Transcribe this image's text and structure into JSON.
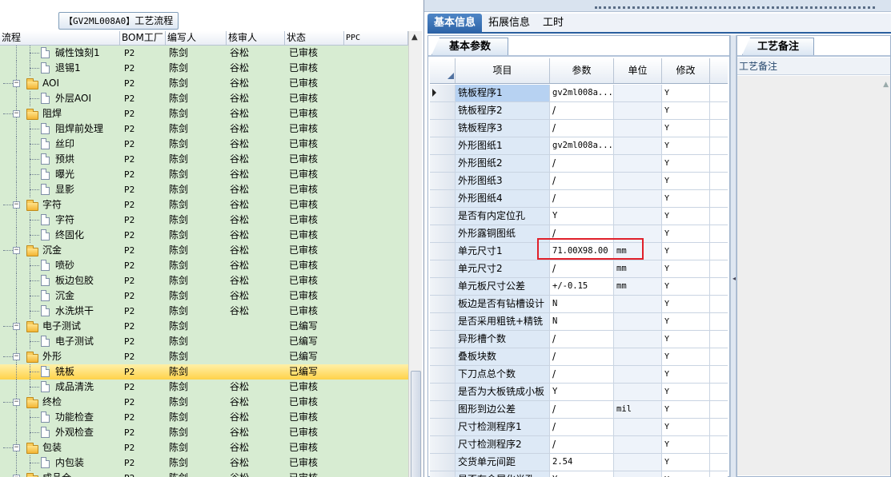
{
  "left": {
    "title_code": "【GV2ML008A0】",
    "title_suffix": "工艺流程",
    "columns": [
      "流程",
      "BOM工厂",
      "编写人",
      "核审人",
      "状态",
      "PPC"
    ],
    "rows": [
      {
        "name": "碱性蚀刻1",
        "type": "doc",
        "level": 2,
        "bom": "P2",
        "writer": "陈剑",
        "reviewer": "谷松",
        "status": "已审核"
      },
      {
        "name": "退锡1",
        "type": "doc",
        "level": 2,
        "bom": "P2",
        "writer": "陈剑",
        "reviewer": "谷松",
        "status": "已审核"
      },
      {
        "name": "AOI",
        "type": "folder",
        "level": 1,
        "bom": "P2",
        "writer": "陈剑",
        "reviewer": "谷松",
        "status": "已审核"
      },
      {
        "name": "外层AOI",
        "type": "doc",
        "level": 2,
        "bom": "P2",
        "writer": "陈剑",
        "reviewer": "谷松",
        "status": "已审核"
      },
      {
        "name": "阻焊",
        "type": "folder",
        "level": 1,
        "bom": "P2",
        "writer": "陈剑",
        "reviewer": "谷松",
        "status": "已审核"
      },
      {
        "name": "阻焊前处理",
        "type": "doc",
        "level": 2,
        "bom": "P2",
        "writer": "陈剑",
        "reviewer": "谷松",
        "status": "已审核"
      },
      {
        "name": "丝印",
        "type": "doc",
        "level": 2,
        "bom": "P2",
        "writer": "陈剑",
        "reviewer": "谷松",
        "status": "已审核"
      },
      {
        "name": "预烘",
        "type": "doc",
        "level": 2,
        "bom": "P2",
        "writer": "陈剑",
        "reviewer": "谷松",
        "status": "已审核"
      },
      {
        "name": "曝光",
        "type": "doc",
        "level": 2,
        "bom": "P2",
        "writer": "陈剑",
        "reviewer": "谷松",
        "status": "已审核"
      },
      {
        "name": "显影",
        "type": "doc",
        "level": 2,
        "bom": "P2",
        "writer": "陈剑",
        "reviewer": "谷松",
        "status": "已审核"
      },
      {
        "name": "字符",
        "type": "folder",
        "level": 1,
        "bom": "P2",
        "writer": "陈剑",
        "reviewer": "谷松",
        "status": "已审核"
      },
      {
        "name": "字符",
        "type": "doc",
        "level": 2,
        "bom": "P2",
        "writer": "陈剑",
        "reviewer": "谷松",
        "status": "已审核"
      },
      {
        "name": "终固化",
        "type": "doc",
        "level": 2,
        "bom": "P2",
        "writer": "陈剑",
        "reviewer": "谷松",
        "status": "已审核"
      },
      {
        "name": "沉金",
        "type": "folder",
        "level": 1,
        "bom": "P2",
        "writer": "陈剑",
        "reviewer": "谷松",
        "status": "已审核"
      },
      {
        "name": "喷砂",
        "type": "doc",
        "level": 2,
        "bom": "P2",
        "writer": "陈剑",
        "reviewer": "谷松",
        "status": "已审核"
      },
      {
        "name": "板边包胶",
        "type": "doc",
        "level": 2,
        "bom": "P2",
        "writer": "陈剑",
        "reviewer": "谷松",
        "status": "已审核"
      },
      {
        "name": "沉金",
        "type": "doc",
        "level": 2,
        "bom": "P2",
        "writer": "陈剑",
        "reviewer": "谷松",
        "status": "已审核"
      },
      {
        "name": "水洗烘干",
        "type": "doc",
        "level": 2,
        "bom": "P2",
        "writer": "陈剑",
        "reviewer": "谷松",
        "status": "已审核"
      },
      {
        "name": "电子测试",
        "type": "folder",
        "level": 1,
        "bom": "P2",
        "writer": "陈剑",
        "reviewer": "",
        "status": "已编写"
      },
      {
        "name": "电子测试",
        "type": "doc",
        "level": 2,
        "bom": "P2",
        "writer": "陈剑",
        "reviewer": "",
        "status": "已编写"
      },
      {
        "name": "外形",
        "type": "folder",
        "level": 1,
        "bom": "P2",
        "writer": "陈剑",
        "reviewer": "",
        "status": "已编写"
      },
      {
        "name": "铣板",
        "type": "doc",
        "level": 2,
        "bom": "P2",
        "writer": "陈剑",
        "reviewer": "",
        "status": "已编写",
        "selected": true
      },
      {
        "name": "成品清洗",
        "type": "doc",
        "level": 2,
        "bom": "P2",
        "writer": "陈剑",
        "reviewer": "谷松",
        "status": "已审核"
      },
      {
        "name": "终检",
        "type": "folder",
        "level": 1,
        "bom": "P2",
        "writer": "陈剑",
        "reviewer": "谷松",
        "status": "已审核"
      },
      {
        "name": "功能检查",
        "type": "doc",
        "level": 2,
        "bom": "P2",
        "writer": "陈剑",
        "reviewer": "谷松",
        "status": "已审核"
      },
      {
        "name": "外观检查",
        "type": "doc",
        "level": 2,
        "bom": "P2",
        "writer": "陈剑",
        "reviewer": "谷松",
        "status": "已审核"
      },
      {
        "name": "包装",
        "type": "folder",
        "level": 1,
        "bom": "P2",
        "writer": "陈剑",
        "reviewer": "谷松",
        "status": "已审核"
      },
      {
        "name": "内包装",
        "type": "doc",
        "level": 2,
        "bom": "P2",
        "writer": "陈剑",
        "reviewer": "谷松",
        "status": "已审核"
      },
      {
        "name": "成品仓",
        "type": "folder",
        "level": 1,
        "bom": "P2",
        "writer": "陈剑",
        "reviewer": "谷松",
        "status": "已审核"
      }
    ]
  },
  "main_tabs": [
    "基本信息",
    "拓展信息",
    "工时"
  ],
  "params": {
    "tab_label": "基本参数",
    "columns": [
      "项目",
      "参数",
      "单位",
      "修改"
    ],
    "rows": [
      {
        "item": "铣板程序1",
        "value": "gv2ml008a...",
        "unit": "",
        "mod": "Y",
        "current": true
      },
      {
        "item": "铣板程序2",
        "value": "/",
        "unit": "",
        "mod": "Y"
      },
      {
        "item": "铣板程序3",
        "value": "/",
        "unit": "",
        "mod": "Y"
      },
      {
        "item": "外形图纸1",
        "value": "gv2ml008a...",
        "unit": "",
        "mod": "Y"
      },
      {
        "item": "外形图纸2",
        "value": "/",
        "unit": "",
        "mod": "Y"
      },
      {
        "item": "外形图纸3",
        "value": "/",
        "unit": "",
        "mod": "Y"
      },
      {
        "item": "外形图纸4",
        "value": "/",
        "unit": "",
        "mod": "Y"
      },
      {
        "item": "是否有内定位孔",
        "value": "Y",
        "unit": "",
        "mod": "Y"
      },
      {
        "item": "外形露铜图纸",
        "value": "/",
        "unit": "",
        "mod": "Y"
      },
      {
        "item": "单元尺寸1",
        "value": "71.00X98.00",
        "unit": "mm",
        "mod": "Y"
      },
      {
        "item": "单元尺寸2",
        "value": "/",
        "unit": "mm",
        "mod": "Y"
      },
      {
        "item": "单元板尺寸公差",
        "value": "+/-0.15",
        "unit": "mm",
        "mod": "Y"
      },
      {
        "item": "板边是否有钻槽设计",
        "value": "N",
        "unit": "",
        "mod": "Y"
      },
      {
        "item": "是否采用粗铣+精铣",
        "value": "N",
        "unit": "",
        "mod": "Y"
      },
      {
        "item": "异形槽个数",
        "value": "/",
        "unit": "",
        "mod": "Y"
      },
      {
        "item": "叠板块数",
        "value": "/",
        "unit": "",
        "mod": "Y"
      },
      {
        "item": "下刀点总个数",
        "value": "/",
        "unit": "",
        "mod": "Y"
      },
      {
        "item": "是否为大板铣成小板",
        "value": "Y",
        "unit": "",
        "mod": "Y"
      },
      {
        "item": "图形到边公差",
        "value": "/",
        "unit": "mil",
        "mod": "Y"
      },
      {
        "item": "尺寸检测程序1",
        "value": "/",
        "unit": "",
        "mod": "Y"
      },
      {
        "item": "尺寸检测程序2",
        "value": "/",
        "unit": "",
        "mod": "Y"
      },
      {
        "item": "交货单元间距",
        "value": "2.54",
        "unit": "",
        "mod": "Y"
      },
      {
        "item": "是否有金属化半孔",
        "value": "Y",
        "unit": "",
        "mod": "Y"
      }
    ]
  },
  "notes": {
    "tab_label": "工艺备注",
    "header": "工艺备注"
  }
}
